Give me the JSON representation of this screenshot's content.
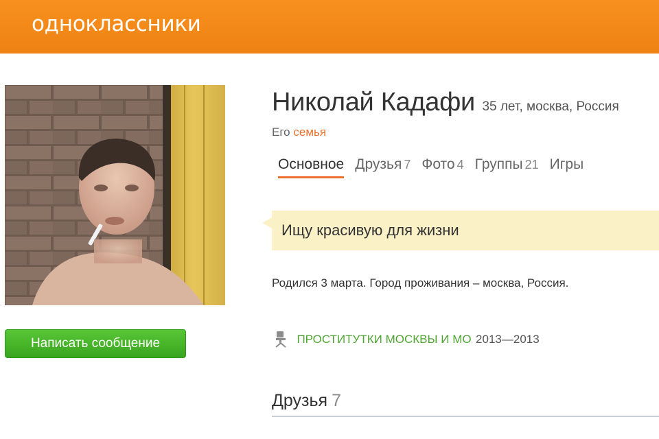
{
  "header": {
    "logo": "одноклассники",
    "color": "#f08718"
  },
  "profile": {
    "name": "Николай Кадафи",
    "meta": "35 лет, москва, Россия",
    "family_prefix": "Его",
    "family_link": "семья",
    "send_message": "Написать сообщение"
  },
  "tabs": [
    {
      "label": "Основное",
      "count": "",
      "active": true
    },
    {
      "label": "Друзья",
      "count": "7"
    },
    {
      "label": "Фото",
      "count": "4"
    },
    {
      "label": "Группы",
      "count": "21"
    },
    {
      "label": "Игры",
      "count": ""
    }
  ],
  "status": "Ищу красивую для жизни",
  "born": "Родился 3 марта. Город проживания – москва, Россия.",
  "education": {
    "icon": "school-chair-icon",
    "name": "ПРОСТИТУТКИ МОСКВЫ И МО",
    "years": "2013—2013"
  },
  "friends": {
    "title": "Друзья",
    "count": "7"
  },
  "colors": {
    "accent": "#eb722e",
    "link_green": "#4ea632",
    "button_green": "#45b22a",
    "status_bg": "#fbf1c6"
  }
}
